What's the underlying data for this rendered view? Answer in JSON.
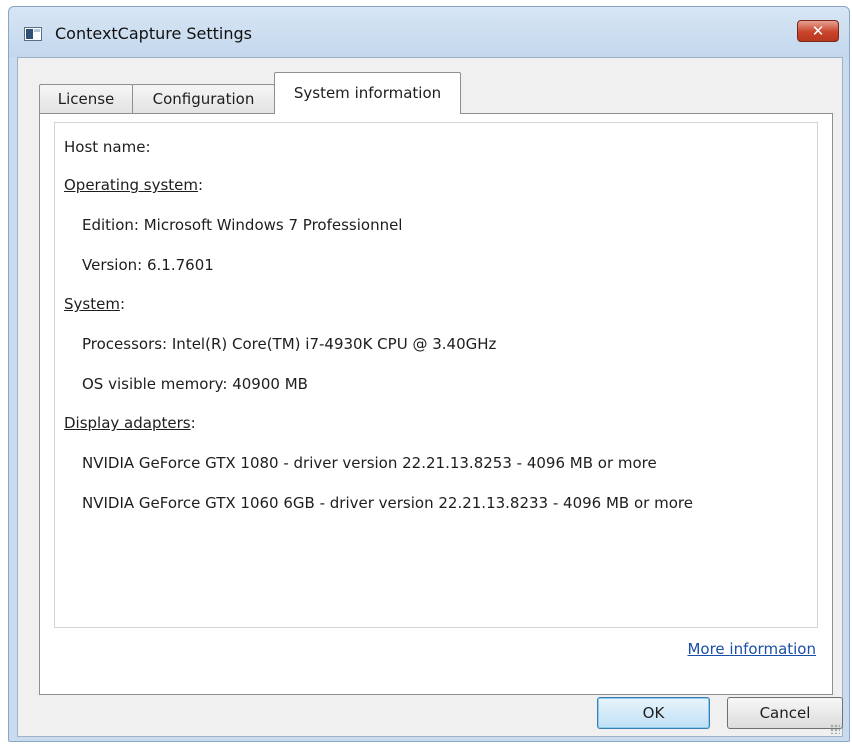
{
  "window": {
    "title": "ContextCapture Settings",
    "close_symbol": "✕"
  },
  "tabs": [
    {
      "label": "License"
    },
    {
      "label": "Configuration"
    },
    {
      "label": "System information"
    }
  ],
  "active_tab": "System information",
  "system_info": {
    "host_name_label": "Host name:",
    "os_heading": "Operating system",
    "os_edition": "Edition: Microsoft Windows 7 Professionnel",
    "os_version": "Version: 6.1.7601",
    "system_heading": "System",
    "processors": "Processors: Intel(R) Core(TM) i7-4930K CPU @ 3.40GHz",
    "memory": "OS visible memory: 40900 MB",
    "display_heading": "Display adapters",
    "adapters": [
      "NVIDIA GeForce GTX 1080 - driver version 22.21.13.8253 - 4096 MB or more",
      "NVIDIA GeForce GTX 1060 6GB - driver version 22.21.13.8233 - 4096 MB or more"
    ],
    "heading_suffix": ":"
  },
  "more_info_link": "More information",
  "buttons": {
    "ok": "OK",
    "cancel": "Cancel"
  },
  "colors": {
    "title_bar": "#c9dcef",
    "close_button": "#c9442b",
    "link": "#1a4fa7",
    "dialog_bg": "#f0f0f0"
  }
}
